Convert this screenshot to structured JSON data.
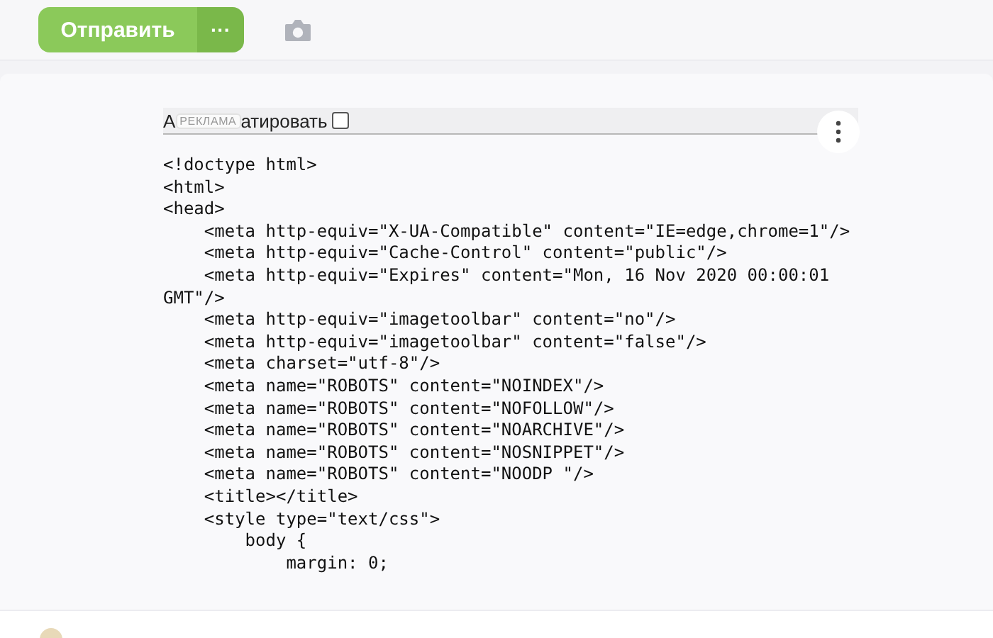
{
  "toolbar": {
    "send_button": "Отправить",
    "more_button": "···"
  },
  "code_panel": {
    "header": {
      "label_start": "А",
      "ad_badge": "РЕКЛАМА",
      "label_end": "атировать",
      "checked": false
    },
    "lines": [
      "<!doctype html>",
      "<html>",
      "<head>",
      "    <meta http-equiv=\"X-UA-Compatible\" content=\"IE=edge,chrome=1\"/>",
      "    <meta http-equiv=\"Cache-Control\" content=\"public\"/>",
      "    <meta http-equiv=\"Expires\" content=\"Mon, 16 Nov 2020 00:00:01",
      "GMT\"/>",
      "    <meta http-equiv=\"imagetoolbar\" content=\"no\"/>",
      "    <meta http-equiv=\"imagetoolbar\" content=\"false\"/>",
      "    <meta charset=\"utf-8\"/>",
      "    <meta name=\"ROBOTS\" content=\"NOINDEX\"/>",
      "    <meta name=\"ROBOTS\" content=\"NOFOLLOW\"/>",
      "    <meta name=\"ROBOTS\" content=\"NOARCHIVE\"/>",
      "    <meta name=\"ROBOTS\" content=\"NOSNIPPET\"/>",
      "    <meta name=\"ROBOTS\" content=\"NOODP \"/>",
      "    <title></title>",
      "    <style type=\"text/css\">",
      "        body {",
      "            margin: 0;"
    ]
  }
}
